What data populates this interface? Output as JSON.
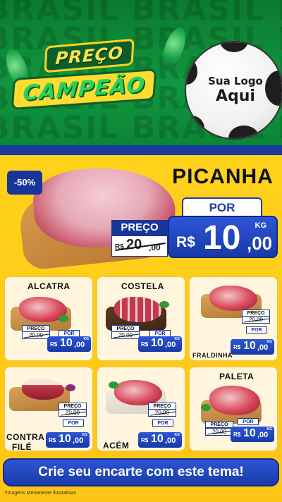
{
  "header": {
    "background_word": "BRASIL BRASIL BRASIL",
    "brand_line_1": "PREÇO",
    "brand_line_2": "CAMPEÃO",
    "logo_line_1": "Sua Logo",
    "logo_line_2": "Aqui"
  },
  "hero": {
    "discount": "-50%",
    "name": "PICANHA",
    "por_label": "POR",
    "old_label": "PREÇO",
    "old_currency": "R$",
    "old_int": "20",
    "old_cents": ",00",
    "new_currency": "R$",
    "new_int": "10",
    "new_cents": ",00",
    "unit": "KG"
  },
  "products": [
    {
      "name": "ALCATRA",
      "old_label": "PREÇO",
      "old_price": "20,00",
      "por_label": "POR",
      "currency": "R$",
      "int": "10",
      "cents": ",00",
      "unit": "KG"
    },
    {
      "name": "COSTELA",
      "old_label": "PREÇO",
      "old_price": "20,00",
      "por_label": "POR",
      "currency": "R$",
      "int": "10",
      "cents": ",00",
      "unit": "KG"
    },
    {
      "name": "FRALDINHA",
      "old_label": "PREÇO",
      "old_price": "20,00",
      "por_label": "POR",
      "currency": "R$",
      "int": "10",
      "cents": ",00",
      "unit": "KG"
    },
    {
      "name_line_1": "CONTRA",
      "name_line_2": "FILÉ",
      "old_label": "PREÇO",
      "old_price": "20,00",
      "por_label": "POR",
      "currency": "R$",
      "int": "10",
      "cents": ",00",
      "unit": "KG"
    },
    {
      "name": "ACÉM",
      "old_label": "PREÇO",
      "old_price": "20,00",
      "por_label": "POR",
      "currency": "R$",
      "int": "10",
      "cents": ",00",
      "unit": "KG"
    },
    {
      "name": "PALETA",
      "old_label": "PREÇO",
      "old_price": "20,00",
      "por_label": "POR",
      "currency": "R$",
      "int": "10",
      "cents": ",00",
      "unit": "KG"
    }
  ],
  "footer": {
    "cta": "Crie seu encarte com este tema!",
    "disclaimer": "*Imagens Meramente Ilustrativas"
  },
  "colors": {
    "green": "#11963f",
    "yellow": "#ffd21c",
    "blue": "#1d3da3"
  }
}
